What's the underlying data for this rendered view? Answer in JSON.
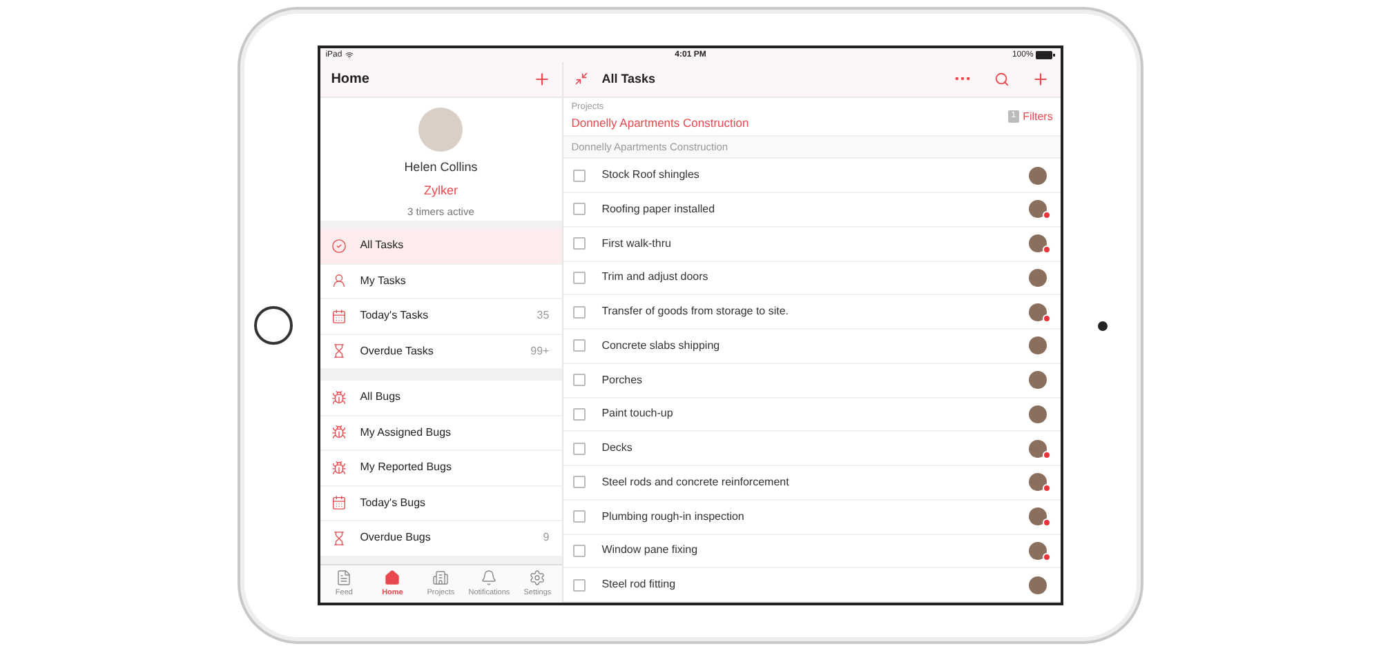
{
  "status_bar": {
    "device": "iPad",
    "time": "4:01 PM",
    "battery": "100%"
  },
  "sidebar": {
    "title": "Home",
    "profile": {
      "name": "Helen Collins",
      "company": "Zylker",
      "timers": "3 timers active"
    },
    "groups": [
      {
        "items": [
          {
            "label": "All Tasks",
            "selected": true
          },
          {
            "label": "My Tasks",
            "selected": false
          },
          {
            "label": "Today's Tasks",
            "count": "35",
            "selected": false
          },
          {
            "label": "Overdue Tasks",
            "count": "99+",
            "selected": false
          }
        ]
      },
      {
        "items": [
          {
            "label": "All Bugs",
            "selected": false
          },
          {
            "label": "My Assigned Bugs",
            "selected": false
          },
          {
            "label": "My Reported Bugs",
            "selected": false
          },
          {
            "label": "Today's Bugs",
            "selected": false
          },
          {
            "label": "Overdue Bugs",
            "count": "9",
            "selected": false
          }
        ]
      }
    ]
  },
  "tab_bar": [
    {
      "label": "Feed",
      "selected": false
    },
    {
      "label": "Home",
      "selected": true
    },
    {
      "label": "Projects",
      "selected": false
    },
    {
      "label": "Notifications",
      "selected": false
    },
    {
      "label": "Settings",
      "selected": false
    }
  ],
  "main": {
    "title": "All Tasks",
    "projects_label": "Projects",
    "project": "Donnelly Apartments Construction",
    "filters": {
      "count": "1",
      "label": "Filters"
    },
    "group_header": "Donnelly Apartments Construction",
    "tasks": [
      {
        "name": "Stock Roof shingles",
        "checked": false,
        "alert": false
      },
      {
        "name": "Roofing paper installed",
        "checked": false,
        "alert": true
      },
      {
        "name": "First walk-thru",
        "checked": false,
        "alert": true
      },
      {
        "name": "Trim and adjust doors",
        "checked": false,
        "alert": false
      },
      {
        "name": "Transfer of goods from storage to site.",
        "checked": false,
        "alert": true
      },
      {
        "name": "Concrete slabs shipping",
        "checked": false,
        "alert": false
      },
      {
        "name": "Porches",
        "checked": false,
        "alert": false
      },
      {
        "name": "Paint touch-up",
        "checked": false,
        "alert": false
      },
      {
        "name": "Decks",
        "checked": false,
        "alert": true
      },
      {
        "name": "Steel rods and concrete reinforcement",
        "checked": false,
        "alert": true
      },
      {
        "name": "Plumbing rough-in inspection",
        "checked": false,
        "alert": true
      },
      {
        "name": "Window pane fixing",
        "checked": false,
        "alert": true
      },
      {
        "name": "Steel rod fitting",
        "checked": false,
        "alert": false
      }
    ]
  }
}
